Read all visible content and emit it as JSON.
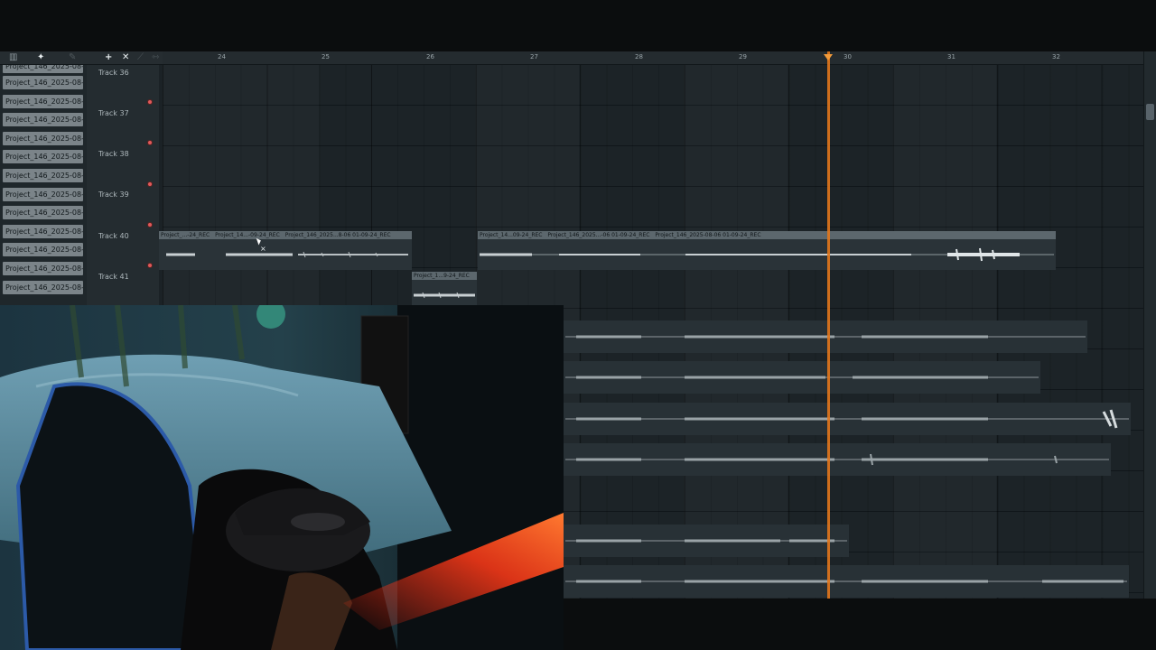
{
  "toolbar": {
    "icons": [
      "snap-icon",
      "waveform-icon",
      "pencil-icon",
      "add-icon",
      "delete-icon"
    ]
  },
  "ruler": {
    "bars": [
      "24",
      "25",
      "26",
      "27",
      "28",
      "29",
      "30",
      "31",
      "32"
    ]
  },
  "picker": {
    "items": [
      "Project_146_2025-08-06...",
      "Project_146_2025-08-06...",
      "Project_146_2025-08-06...",
      "Project_146_2025-08-06...",
      "Project_146_2025-08-06...",
      "Project_146_2025-08-06...",
      "Project_146_2025-08-06...",
      "Project_146_2025-08-06...",
      "Project_146_2025-08-06...",
      "Project_146_2025-08-06...",
      "Project_146_2025-08-06...",
      "Project_146_2025-08-06...",
      "Project_146_2025-08-06..."
    ]
  },
  "tracks": [
    {
      "label": "Track 36"
    },
    {
      "label": "Track 37"
    },
    {
      "label": "Track 38"
    },
    {
      "label": "Track 39"
    },
    {
      "label": "Track 40"
    },
    {
      "label": "Track 41"
    }
  ],
  "clips": {
    "track40_a": "Project_...-24_REC",
    "track40_b": "Project_14...-09-24_REC",
    "track40_c": "Project_146_2025...8-06 01-09-24_REC",
    "track40_d": "Project_14...09-24_REC",
    "track40_e": "Project_146_2025...-06 01-09-24_REC",
    "track40_f": "Project_146_2025-08-06 01-09-24_REC",
    "track41_a": "Project_1...9-24_REC"
  },
  "colors": {
    "playhead": "#e2771c",
    "clip_header": "#5c676d",
    "record_indicator": "#e05a5a"
  }
}
